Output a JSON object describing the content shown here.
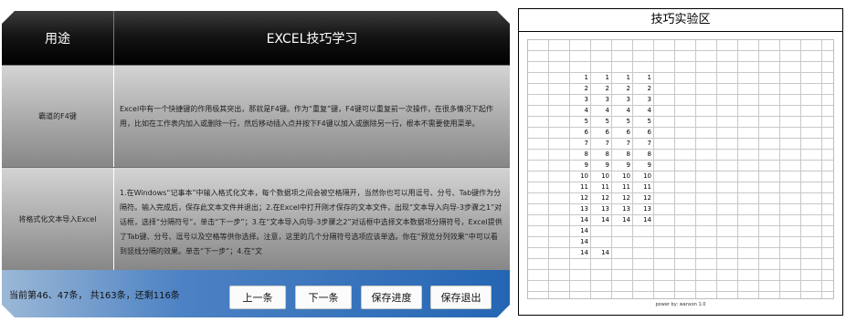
{
  "left": {
    "header": {
      "col1": "用途",
      "col2": "EXCEL技巧学习"
    },
    "rows": [
      {
        "name": "霸道的F4键",
        "text": "Excel中有一个快捷键的作用极其突出，那就是F4键。作为“重复”键，F4键可以重复前一次操作，在很多情况下起作用，比如在工作表内加入或删除一行，然后移动插入点并按下F4键以加入或删除另一行，根本不需要使用菜单。"
      },
      {
        "name": "将格式化文本导入Excel",
        "text": "1.在Windows“记事本”中输入格式化文本，每个数据项之间会被空格隔开，当然你也可以用逗号、分号、Tab键作为分隔符。输入完成后，保存此文本文件并退出；2.在Excel中打开刚才保存的文本文件，出现“文本导入向导-3步骤之1”对话框，选择“分隔符号”，单击“下一步”；3.在“文本导入向导-3步骤之2”对话框中选择文本数据项分隔符号，Excel提供了Tab键、分号、逗号以及空格等供你选择。注意，这里的几个分隔符号选项应该单选。你在“预览分列效果”中可以看到竖线分隔的效果。单击“下一步”；4.在“文"
      }
    ],
    "footer": {
      "status": "当前第46、47条，  共163条，还剩116条",
      "buttons": [
        "上一条",
        "下一条",
        "保存进度",
        "保存退出"
      ]
    }
  },
  "right": {
    "title": "技巧实验区",
    "footer": "power by: wanxon 1.0",
    "numbers": [
      [
        "1",
        "1",
        "1",
        "1"
      ],
      [
        "2",
        "2",
        "2",
        "2"
      ],
      [
        "3",
        "3",
        "3",
        "3"
      ],
      [
        "4",
        "4",
        "4",
        "4"
      ],
      [
        "5",
        "5",
        "5",
        "5"
      ],
      [
        "6",
        "6",
        "6",
        "6"
      ],
      [
        "7",
        "7",
        "7",
        "7"
      ],
      [
        "8",
        "8",
        "8",
        "8"
      ],
      [
        "9",
        "9",
        "9",
        "9"
      ],
      [
        "10",
        "10",
        "10",
        "10"
      ],
      [
        "11",
        "11",
        "11",
        "11"
      ],
      [
        "12",
        "12",
        "12",
        "12"
      ],
      [
        "13",
        "13",
        "13",
        "13"
      ],
      [
        "14",
        "14",
        "14",
        "14"
      ],
      [
        "14",
        "",
        "",
        ""
      ],
      [
        "14",
        "",
        "",
        ""
      ],
      [
        "14",
        "14",
        "",
        ""
      ]
    ]
  },
  "colors": {
    "header_bg": "#000000",
    "row_bg": "#a9a9a9",
    "footer_bg": "#2466b3",
    "button_bg": "#fbfbfb"
  }
}
